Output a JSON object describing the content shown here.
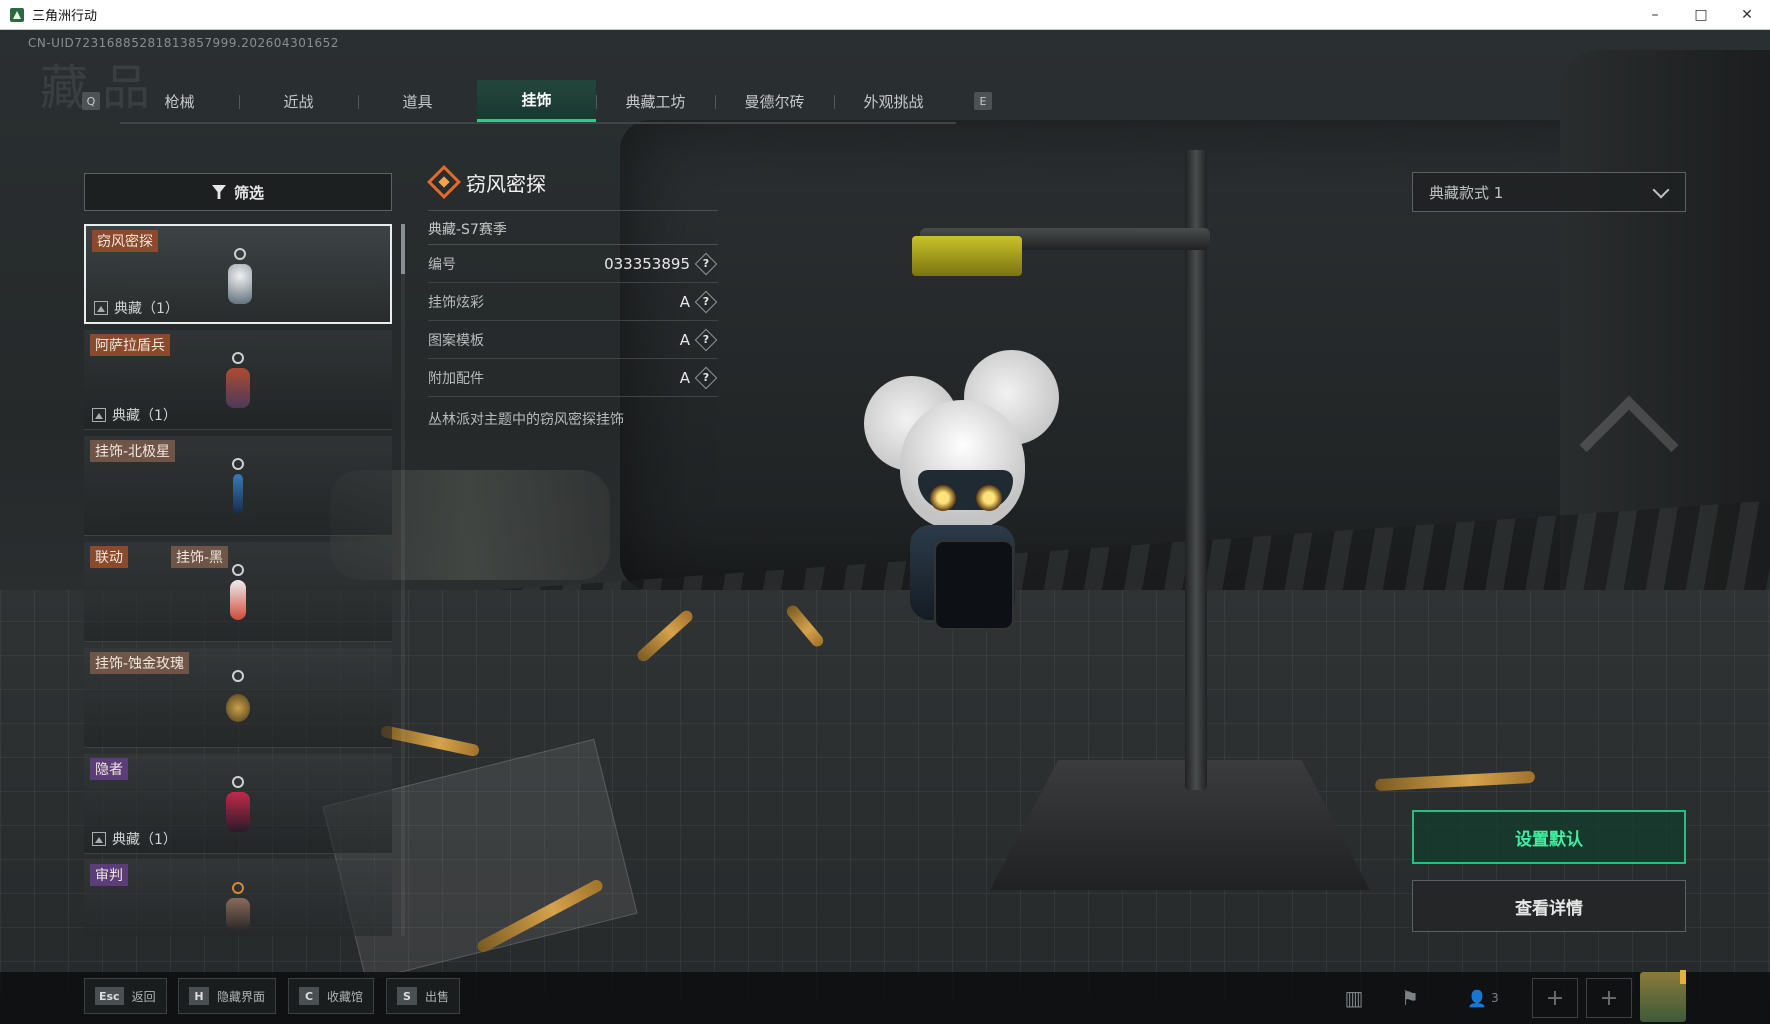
{
  "window": {
    "title": "三角洲行动",
    "controls": [
      "–",
      "□",
      "✕"
    ]
  },
  "header": {
    "uid": "CN-UID72316885281813857999.202604301652",
    "watermark": "藏品"
  },
  "tabs": {
    "left_key": "Q",
    "right_key": "E",
    "items": [
      "枪械",
      "近战",
      "道具",
      "挂饰",
      "典藏工坊",
      "曼德尔砖",
      "外观挑战"
    ],
    "active": "挂饰"
  },
  "filter": {
    "label": "筛选",
    "icon": "filter-icon"
  },
  "list": {
    "items": [
      {
        "tag": "窃风密探",
        "tag_color": "#8a4a2b",
        "collection": "典藏（1）",
        "selected": true
      },
      {
        "tag": "阿萨拉盾兵",
        "tag_color": "#8a4a2b",
        "collection": "典藏（1）",
        "selected": false
      },
      {
        "tag": "挂饰-北极星",
        "tag_color": "#6f5548",
        "collection": "",
        "selected": false
      },
      {
        "tag": "联动",
        "tag2": "挂饰-黑",
        "tag_color": "#8a4a2b",
        "collection": "",
        "selected": false
      },
      {
        "tag": "挂饰-蚀金玫瑰",
        "tag_color": "#6f5548",
        "collection": "",
        "selected": false
      },
      {
        "tag": "隐者",
        "tag_color": "#5b3d7a",
        "collection": "典藏（1）",
        "selected": false
      },
      {
        "tag": "审判",
        "tag_color": "#5b3d7a",
        "collection": "",
        "selected": false
      }
    ]
  },
  "detail": {
    "name": "窃风密探",
    "season": "典藏-S7赛季",
    "attributes": [
      {
        "label": "编号",
        "value": "033353895"
      },
      {
        "label": "挂饰炫彩",
        "value": "A"
      },
      {
        "label": "图案模板",
        "value": "A"
      },
      {
        "label": "附加配件",
        "value": "A"
      }
    ],
    "help_glyph": "?",
    "description": "丛林派对主题中的窃风密探挂饰"
  },
  "style_select": {
    "value": "典藏款式 1"
  },
  "actions": {
    "set_default": "设置默认",
    "view_details": "查看详情"
  },
  "bottom": {
    "hints": [
      {
        "key": "Esc",
        "label": "返回"
      },
      {
        "key": "H",
        "label": "隐藏界面"
      },
      {
        "key": "C",
        "label": "收藏馆"
      },
      {
        "key": "S",
        "label": "出售"
      }
    ],
    "squad_count": "3",
    "add_glyph": "+"
  },
  "colors": {
    "accent_green": "#23d18b",
    "tag_orange": "#8a4a2b",
    "tag_purple": "#5b3d7a",
    "diamond_orange": "#e26a2c"
  }
}
